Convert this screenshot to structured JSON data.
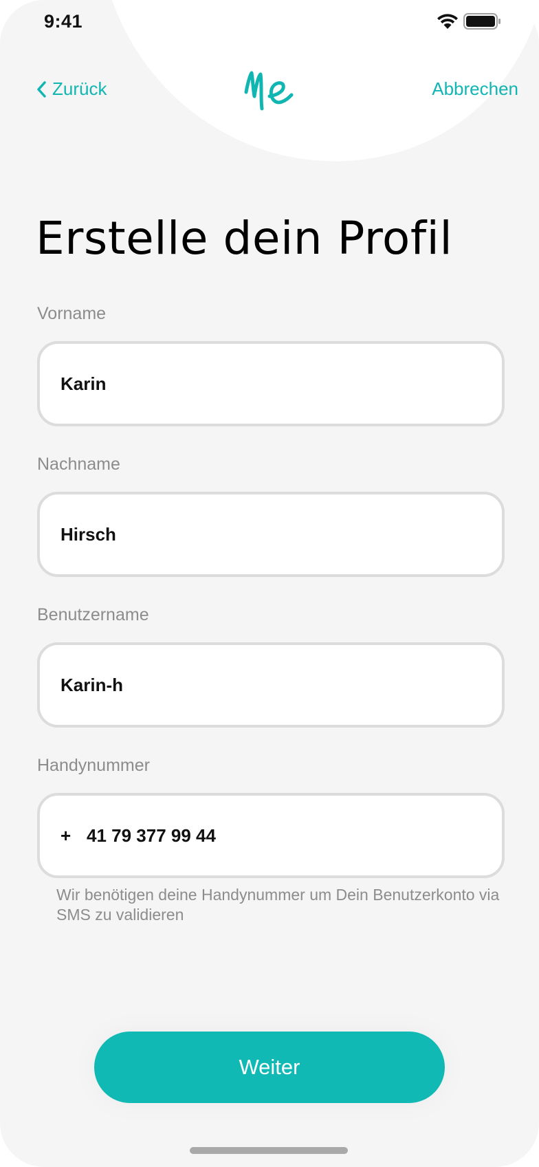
{
  "status_bar": {
    "time": "9:41"
  },
  "nav": {
    "back_label": "Zurück",
    "logo_text": "Me",
    "cancel_label": "Abbrechen"
  },
  "page": {
    "title": "Erstelle dein Profil"
  },
  "form": {
    "first_name": {
      "label": "Vorname",
      "value": "Karin"
    },
    "last_name": {
      "label": "Nachname",
      "value": "Hirsch"
    },
    "username": {
      "label": "Benutzername",
      "value": "Karin-h"
    },
    "phone": {
      "label": "Handynummer",
      "prefix": "+",
      "value": "41 79 377 99 44",
      "helper": "Wir benötigen deine Handynummer um Dein Benutzerkonto via SMS zu validieren"
    }
  },
  "actions": {
    "continue_label": "Weiter"
  },
  "colors": {
    "accent": "#11b5b2",
    "background": "#f5f5f5",
    "label": "#8c8c8c",
    "field_border": "#dcdcdc"
  },
  "icons": [
    "wifi-icon",
    "battery-icon",
    "chevron-left-icon",
    "me-logo"
  ]
}
